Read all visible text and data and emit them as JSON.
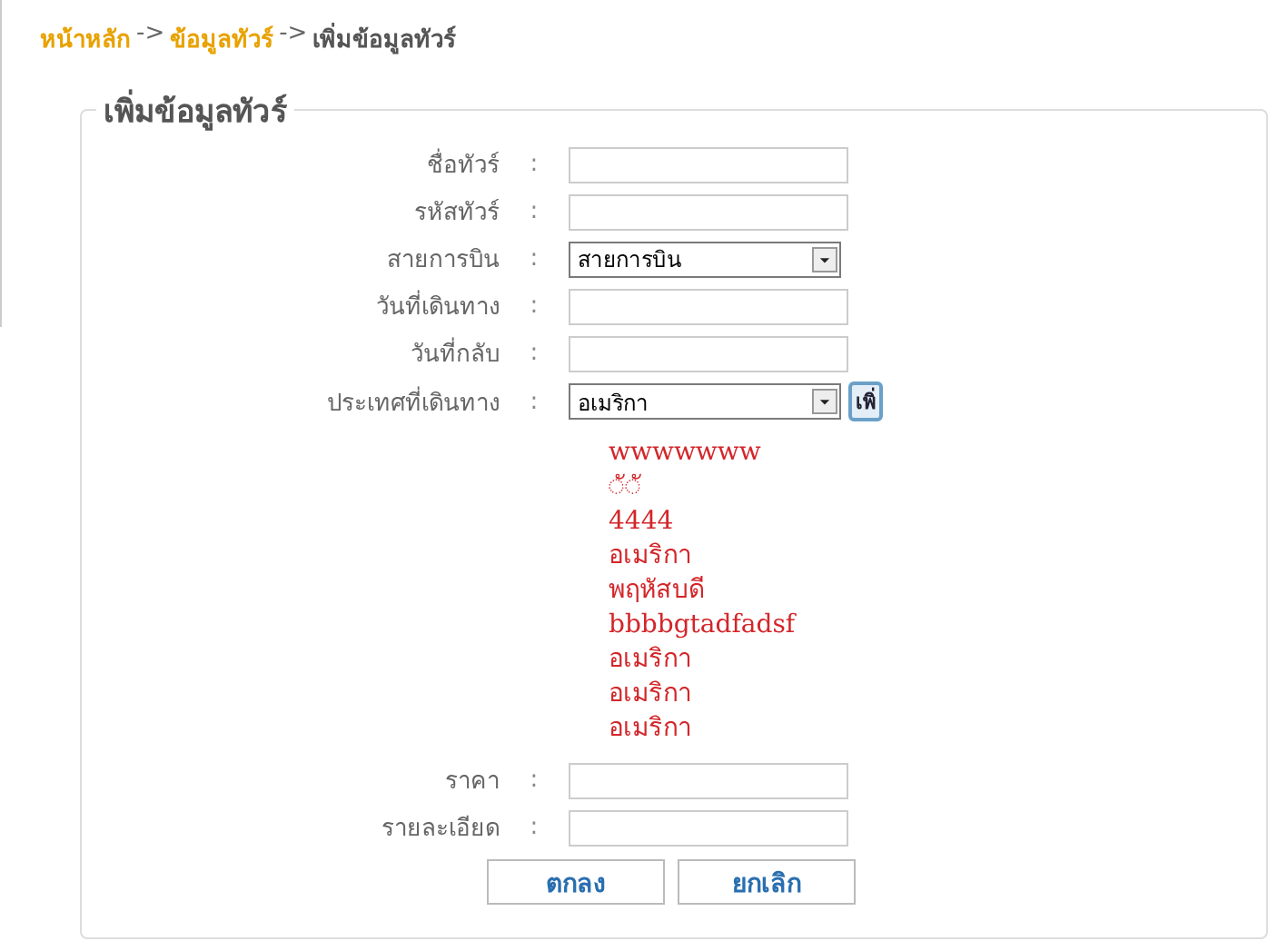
{
  "breadcrumb": [
    {
      "label": "หน้าหลัก",
      "kind": "link"
    },
    {
      "label": "->",
      "kind": "separator"
    },
    {
      "label": "ข้อมูลทัวร์",
      "kind": "link"
    },
    {
      "label": "->",
      "kind": "separator"
    },
    {
      "label": "เพิ่มข้อมูลทัวร์",
      "kind": "current"
    }
  ],
  "form": {
    "legend": "เพิ่มข้อมูลทัวร์",
    "fields": [
      {
        "label": "ชื่อทัวร์",
        "colon": ":",
        "kind": "text"
      },
      {
        "label": "รหัสทัวร์",
        "colon": ":",
        "kind": "text"
      },
      {
        "label": "สายการบิน",
        "colon": ":",
        "kind": "select",
        "value": "สายการบิน"
      },
      {
        "label": "วันที่เดินทาง",
        "colon": ":",
        "kind": "text"
      },
      {
        "label": "วันที่กลับ",
        "colon": ":",
        "kind": "text"
      },
      {
        "label": "ประเทศที่เดินทาง",
        "colon": ":",
        "kind": "select",
        "value": "อเมริกา",
        "add_button": "เพิ่"
      }
    ],
    "countries": [
      "wwwwwww",
      "◌ั◌ั",
      "4444",
      "อเมริกา",
      "พฤหัสบดี",
      "bbbbgtadfadsf",
      "อเมริกา",
      "อเมริกา",
      "อเมริกา"
    ],
    "fields_after": [
      {
        "label": "ราคา",
        "colon": ":",
        "kind": "text"
      },
      {
        "label": "รายละเอียด",
        "colon": ":",
        "kind": "text"
      }
    ],
    "buttons": [
      "ตกลง",
      "ยกเลิก"
    ]
  }
}
